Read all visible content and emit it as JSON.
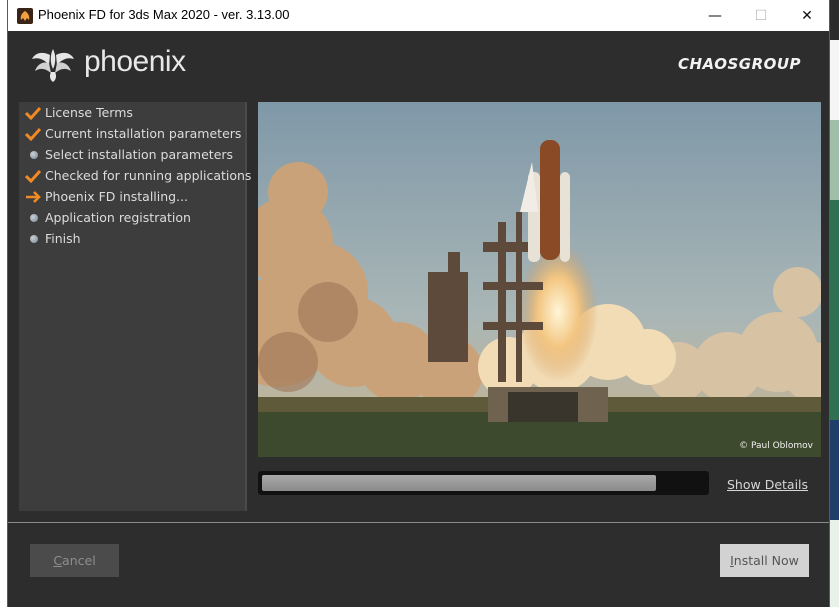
{
  "window": {
    "title": "Phoenix FD for 3ds Max 2020 - ver. 3.13.00",
    "controls": {
      "minimize": "—",
      "maximize": "☐",
      "close": "✕"
    }
  },
  "header": {
    "product_logo_text": "phoenix",
    "vendor_logo_text": "CHAOSGROUP"
  },
  "steps": [
    {
      "label": "License Terms",
      "state": "done"
    },
    {
      "label": "Current installation parameters",
      "state": "done"
    },
    {
      "label": "Select installation parameters",
      "state": "pending"
    },
    {
      "label": "Checked for running applications",
      "state": "done"
    },
    {
      "label": "Phoenix FD installing...",
      "state": "current"
    },
    {
      "label": "Application registration",
      "state": "pending"
    },
    {
      "label": "Finish",
      "state": "pending"
    }
  ],
  "image": {
    "credit": "© Paul Oblomov"
  },
  "progress": {
    "fraction": 0.89,
    "link_label": "Show Details"
  },
  "buttons": {
    "cancel_first": "C",
    "cancel_rest": "ancel",
    "install_first": "I",
    "install_rest": "nstall Now"
  },
  "colors": {
    "window_bg": "#2d2d2d",
    "panel_bg": "#3d3d3d",
    "check_orange": "#f08a24",
    "progress_fill": "#9a9a9a"
  }
}
